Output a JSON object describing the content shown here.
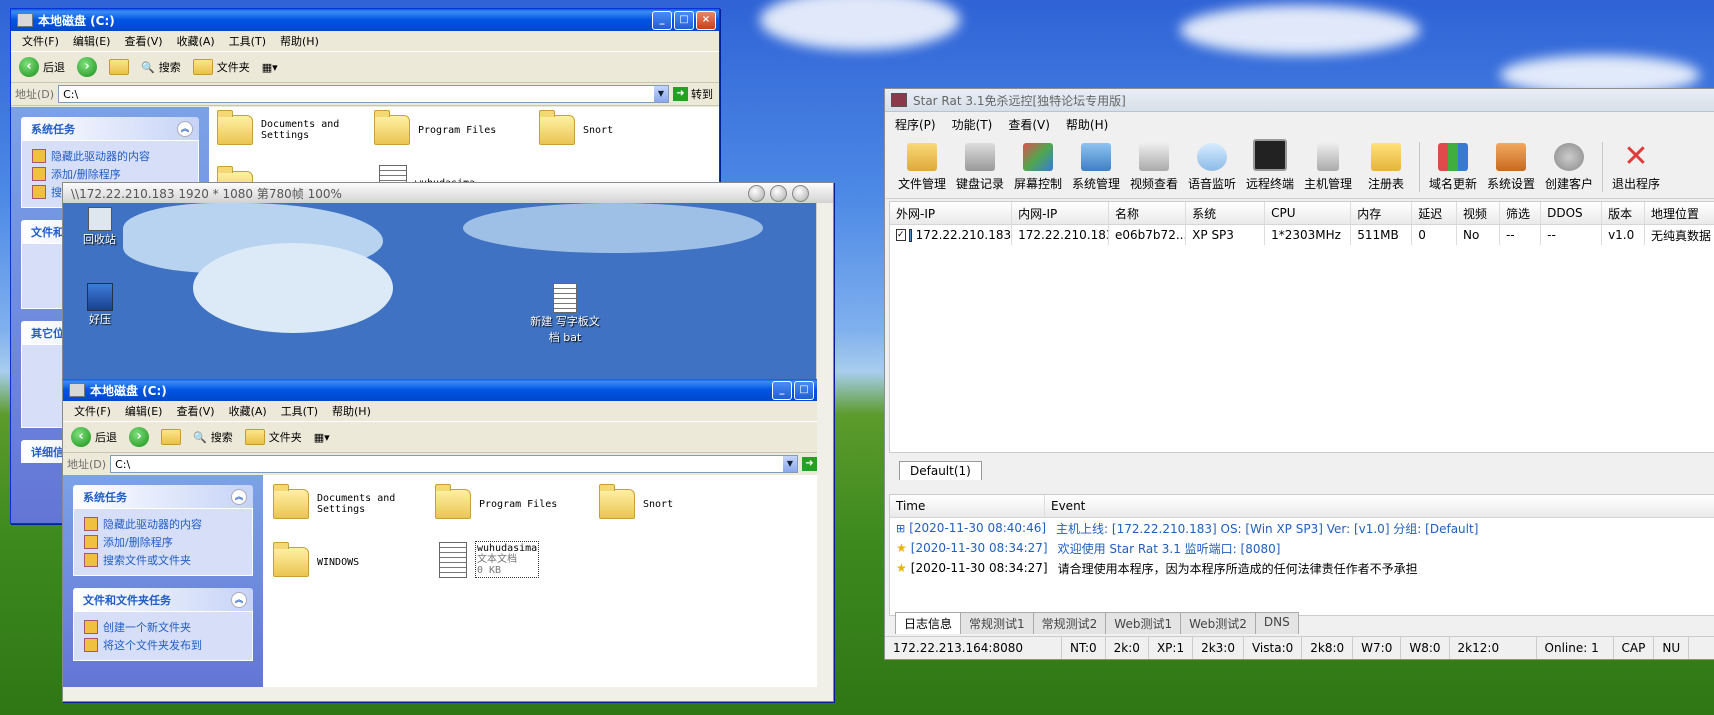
{
  "explorer": {
    "title": "本地磁盘 (C:)",
    "menu": [
      "文件(F)",
      "编辑(E)",
      "查看(V)",
      "收藏(A)",
      "工具(T)",
      "帮助(H)"
    ],
    "toolbar": {
      "back": "后退",
      "search": "搜索",
      "folders": "文件夹"
    },
    "address_label": "地址(D)",
    "address_value": "C:\\",
    "go_label": "转到",
    "tasks": {
      "system_title": "系统任务",
      "system_items": [
        "隐藏此驱动器的内容",
        "添加/删除程序",
        "搜索文件或文件夹"
      ],
      "file_title": "文件和文件夹任务",
      "file_items": [
        "创建一个新文件夹",
        "将这个文件夹发布到"
      ],
      "other_title": "其它位置",
      "detail_title": "详细信息"
    },
    "files": {
      "docs": "Documents and Settings",
      "program": "Program Files",
      "snort": "Snort",
      "windows": "WINDOWS",
      "text_name": "wuhudasima",
      "text_type": "文本文档",
      "text_size": "0 KB"
    }
  },
  "remote": {
    "title": "\\\\172.22.210.183 1920 * 1080 第780帧 100%",
    "desktop_icons": {
      "recycle": "回收站",
      "haozip": "好压",
      "newdoc": "新建 写字板文档 bat"
    }
  },
  "starrat": {
    "title": "Star Rat 3.1免杀远控[独特论坛专用版]",
    "menu": [
      "程序(P)",
      "功能(T)",
      "查看(V)",
      "帮助(H)"
    ],
    "tools": [
      "文件管理",
      "键盘记录",
      "屏幕控制",
      "系统管理",
      "视频查看",
      "语音监听",
      "远程终端",
      "主机管理",
      "注册表",
      "域名更新",
      "系统设置",
      "创建客户",
      "退出程序"
    ],
    "columns": [
      "外网-IP",
      "内网-IP",
      "名称",
      "系统",
      "CPU",
      "内存",
      "延迟",
      "视频",
      "筛选",
      "DDOS",
      "版本",
      "地理位置"
    ],
    "row": [
      "172.22.210.183",
      "172.22.210.183",
      "e06b7b72...",
      "XP SP3",
      "1*2303MHz",
      "511MB",
      "0",
      "No",
      "--",
      "--",
      "v1.0",
      "无纯真数据"
    ],
    "group_tab": "Default(1)",
    "log_headers": [
      "Time",
      "Event"
    ],
    "log_rows": [
      {
        "time": "[2020-11-30 08:40:46]",
        "event": "主机上线: [172.22.210.183]   OS: [Win XP SP3]   Ver: [v1.0]   分组: [Default]"
      },
      {
        "time": "[2020-11-30 08:34:27]",
        "event": "欢迎使用 Star Rat 3.1   监听端口: [8080]"
      },
      {
        "time": "[2020-11-30 08:34:27]",
        "event": "请合理使用本程序，因为本程序所造成的任何法律责任作者不予承担"
      }
    ],
    "log_tabs": [
      "日志信息",
      "常规测试1",
      "常规测试2",
      "Web测试1",
      "Web测试2",
      "DNS"
    ],
    "status": [
      "172.22.213.164:8080",
      "NT:0",
      "2k:0",
      "XP:1",
      "2k3:0",
      "Vista:0",
      "2k8:0",
      "W7:0",
      "W8:0",
      "2k12:0",
      "Online: 1",
      "CAP",
      "NU"
    ],
    "colors": {
      "log_blue": "#1f5fbf"
    }
  }
}
